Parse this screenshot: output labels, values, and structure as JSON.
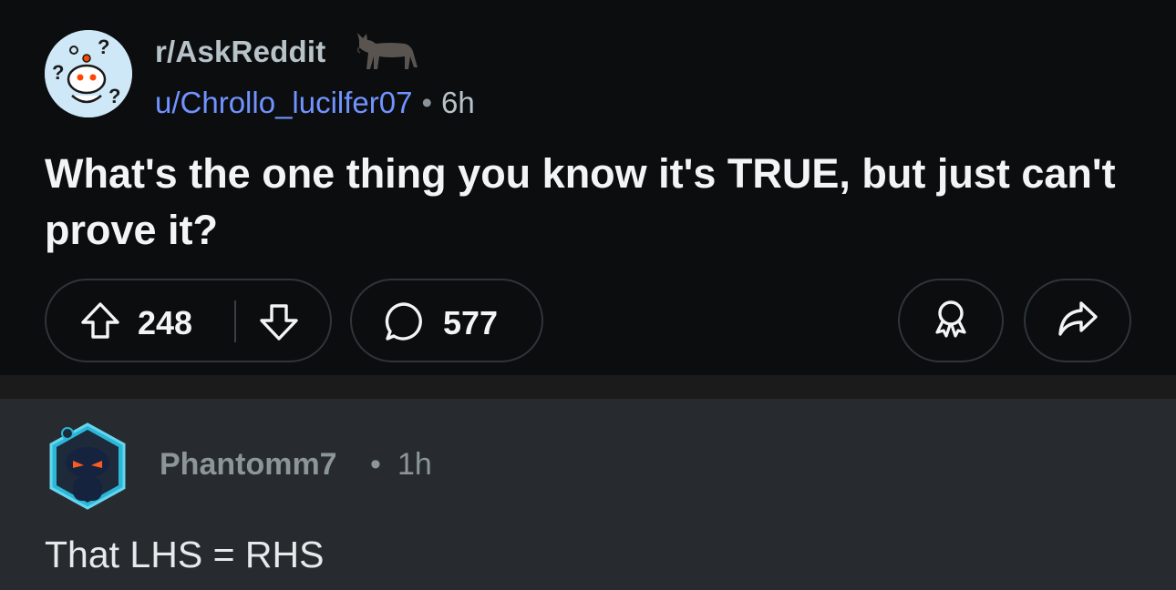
{
  "post": {
    "subreddit": "r/AskReddit",
    "author": "u/Chrollo_lucilfer07",
    "separator": "•",
    "age": "6h",
    "title": "What's the one thing you know it's TRUE, but just can't prove it?",
    "upvotes": "248",
    "comments": "577",
    "icons": [
      "subreddit-avatar",
      "donkey-flair-icon",
      "upvote-icon",
      "downvote-icon",
      "comment-icon",
      "award-icon",
      "share-icon"
    ]
  },
  "comment": {
    "author": "Phantomm7",
    "separator": "•",
    "age": "1h",
    "body": "That LHS = RHS"
  },
  "colors": {
    "background": "#0b0d0f",
    "comment_background": "#272b2f",
    "link_blue": "#7193ff",
    "muted": "#8c9599"
  }
}
